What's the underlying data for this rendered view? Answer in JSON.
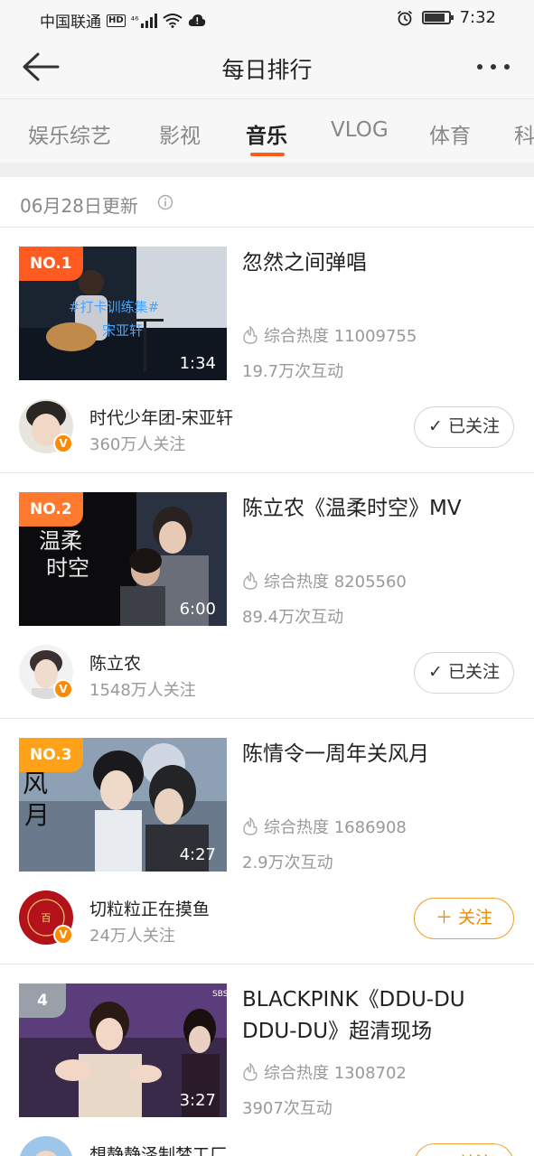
{
  "status_bar": {
    "carrier": "中国联通",
    "hd": "HD",
    "network": "⁴⁶",
    "time": "7:32"
  },
  "nav": {
    "title": "每日排行"
  },
  "tabs": [
    {
      "label": "娱乐综艺",
      "active": false
    },
    {
      "label": "影视",
      "active": false
    },
    {
      "label": "音乐",
      "active": true
    },
    {
      "label": "VLOG",
      "active": false
    },
    {
      "label": "体育",
      "active": false
    },
    {
      "label": "科",
      "active": false
    }
  ],
  "update_text": "06月28日更新",
  "items": [
    {
      "rank": "NO.1",
      "rank_color": "#ff5a1f",
      "title": "忽然之间弹唱",
      "duration": "1:34",
      "heat": "综合热度 11009755",
      "interactions": "19.7万次互动",
      "author": "时代少年团-宋亚轩",
      "followers": "360万人关注",
      "follow_label": "已关注",
      "followed": true
    },
    {
      "rank": "NO.2",
      "rank_color": "#ff7a2f",
      "title": "陈立农《温柔时空》MV",
      "duration": "6:00",
      "heat": "综合热度 8205560",
      "interactions": "89.4万次互动",
      "author": "陈立农",
      "followers": "1548万人关注",
      "follow_label": "已关注",
      "followed": true
    },
    {
      "rank": "NO.3",
      "rank_color": "#ffa21a",
      "title": "陈情令一周年关风月",
      "duration": "4:27",
      "heat": "综合热度 1686908",
      "interactions": "2.9万次互动",
      "author": "切粒粒正在摸鱼",
      "followers": "24万人关注",
      "follow_label": "关注",
      "followed": false
    },
    {
      "rank": "4",
      "rank_color": "#9aa0aa",
      "title": "BLACKPINK《DDU-DU DDU-DU》超清现场",
      "duration": "3:27",
      "heat": "综合热度 1308702",
      "interactions": "3907次互动",
      "author": "想静静泽制梦工厂",
      "followers": "",
      "follow_label": "关注",
      "followed": false
    }
  ],
  "colors": {
    "accent": "#ff5a1f",
    "follow_orange": "#f08a00"
  }
}
